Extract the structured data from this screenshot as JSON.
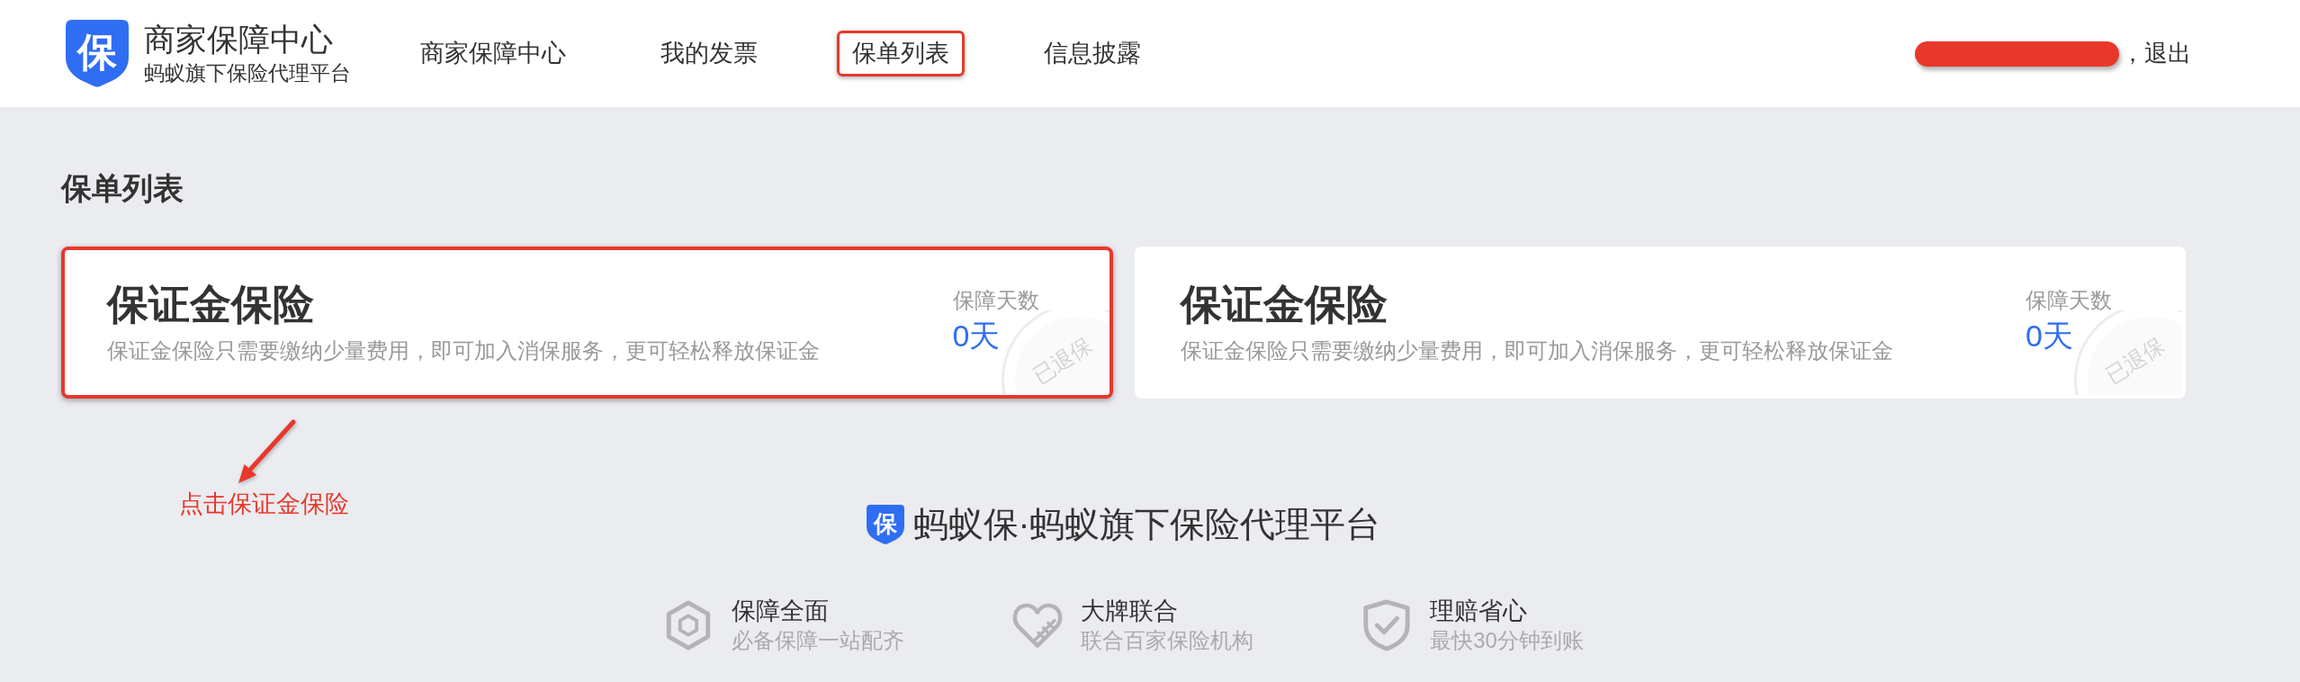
{
  "header": {
    "logo_glyph": "保",
    "title": "商家保障中心",
    "subtitle": "蚂蚁旗下保险代理平台",
    "nav": [
      {
        "label": "商家保障中心",
        "highlighted": false
      },
      {
        "label": "我的发票",
        "highlighted": false
      },
      {
        "label": "保单列表",
        "highlighted": true
      },
      {
        "label": "信息披露",
        "highlighted": false
      }
    ],
    "user": {
      "redacted": true,
      "greeting": "，",
      "logout": "退出"
    }
  },
  "page_title": "保单列表",
  "policies": [
    {
      "title": "保证金保险",
      "description": "保证金保险只需要缴纳少量费用，即可加入消保服务，更可轻松释放保证金",
      "days_label": "保障天数",
      "days": "0天",
      "stamp": "已退保",
      "highlighted": true
    },
    {
      "title": "保证金保险",
      "description": "保证金保险只需要缴纳少量费用，即可加入消保服务，更可轻松释放保证金",
      "days_label": "保障天数",
      "days": "0天",
      "stamp": "已退保",
      "highlighted": false
    }
  ],
  "annotation": {
    "text": "点击保证金保险"
  },
  "footer": {
    "logo_glyph": "保",
    "brand": "蚂蚁保·蚂蚁旗下保险代理平台",
    "features": [
      {
        "kind": "hexagon",
        "title": "保障全面",
        "subtitle": "必备保障一站配齐"
      },
      {
        "kind": "heart",
        "title": "大牌联合",
        "subtitle": "联合百家保险机构"
      },
      {
        "kind": "shield",
        "title": "理赔省心",
        "subtitle": "最快30分钟到账"
      }
    ]
  }
}
